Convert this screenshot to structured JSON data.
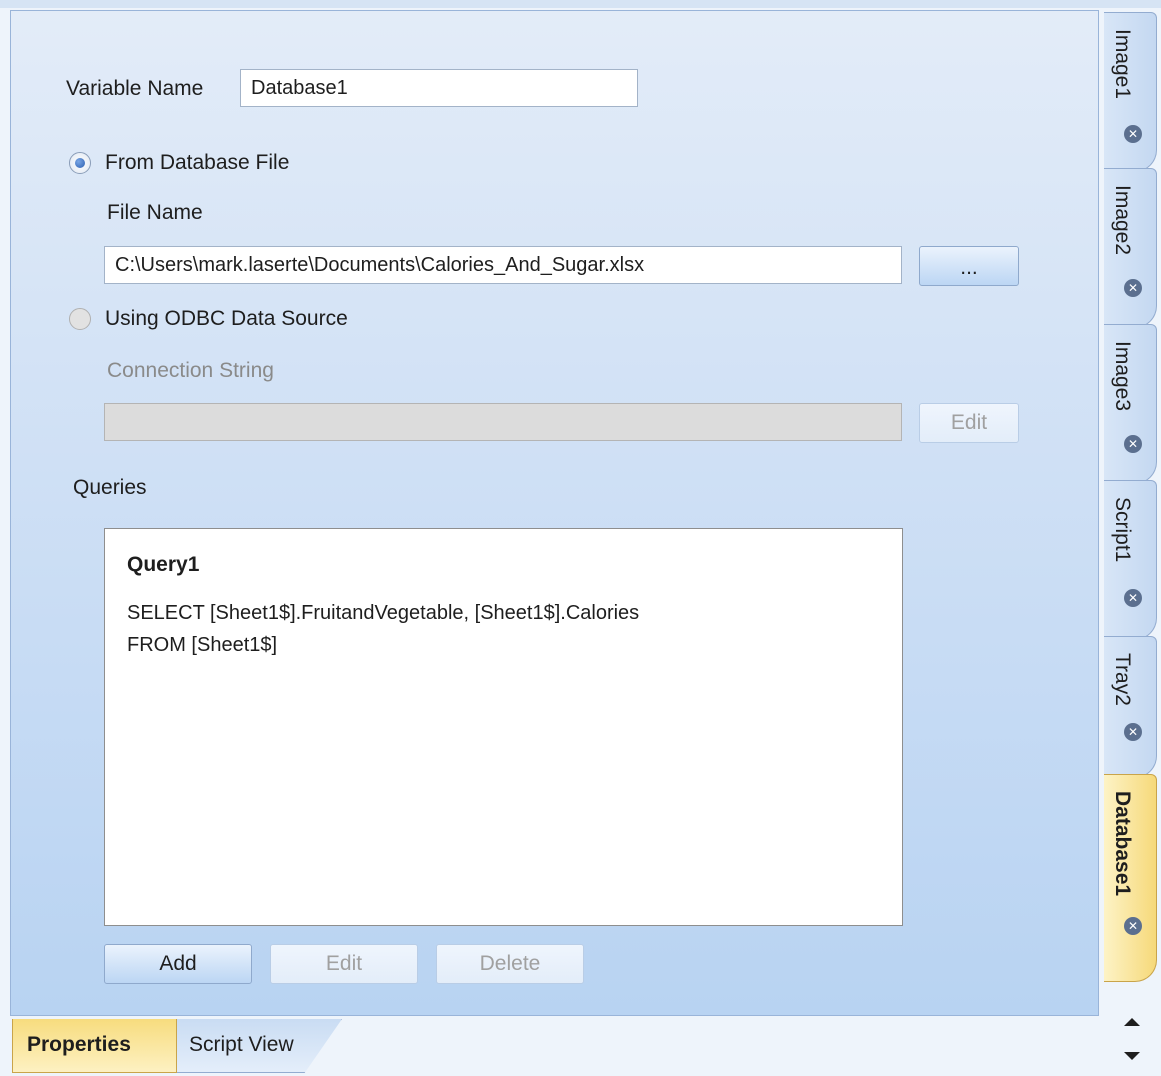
{
  "form": {
    "variable_name_label": "Variable Name",
    "variable_name_value": "Database1",
    "from_db_file_label": "From Database File",
    "file_name_label": "File Name",
    "file_name_value": "C:\\Users\\mark.laserte\\Documents\\Calories_And_Sugar.xlsx",
    "browse_label": "...",
    "odbc_label": "Using ODBC Data Source",
    "connection_string_label": "Connection String",
    "connection_string_value": "",
    "edit_connection_label": "Edit",
    "queries_label": "Queries",
    "query": {
      "name": "Query1",
      "sql_line1": "SELECT [Sheet1$].FruitandVegetable, [Sheet1$].Calories",
      "sql_line2": "FROM [Sheet1$]"
    },
    "add_label": "Add",
    "edit_label": "Edit",
    "delete_label": "Delete"
  },
  "side_tabs": [
    {
      "label": "Image1"
    },
    {
      "label": "Image2"
    },
    {
      "label": "Image3"
    },
    {
      "label": "Script1"
    },
    {
      "label": "Tray2"
    },
    {
      "label": "Database1"
    }
  ],
  "bottom_tabs": [
    {
      "label": "Properties"
    },
    {
      "label": "Script View"
    }
  ],
  "icons": {
    "tab_close": "close-circle-icon",
    "scroll_up": "arrow-up-icon",
    "scroll_down": "arrow-down-icon"
  },
  "colors": {
    "active_tab": "#f6d97a",
    "panel": "#cfe0f5",
    "radio_dot": "#2d5fb0"
  }
}
